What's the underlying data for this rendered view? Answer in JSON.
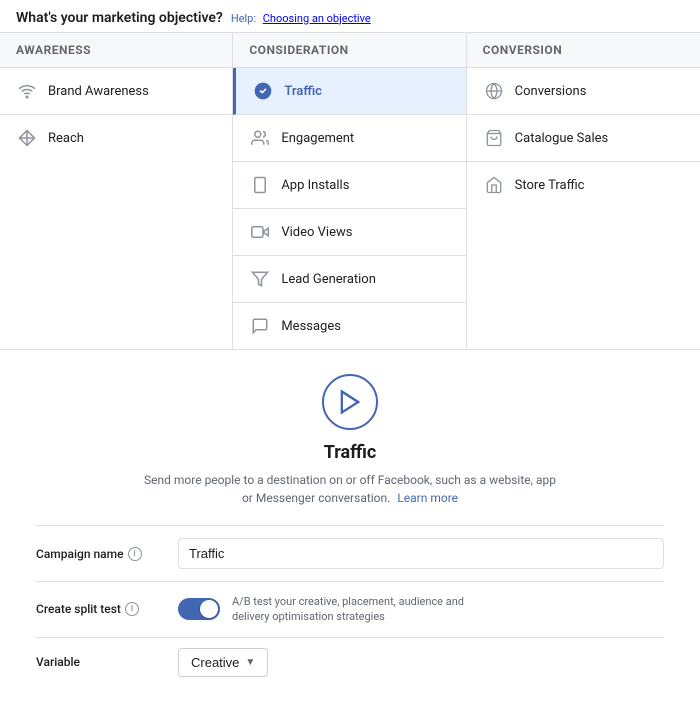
{
  "header": {
    "title": "What's your marketing objective?",
    "help_prefix": "Help:",
    "help_link": "Choosing an objective"
  },
  "columns": [
    {
      "id": "awareness",
      "header": "Awareness",
      "items": [
        {
          "id": "brand-awareness",
          "label": "Brand Awareness",
          "icon": "wifi",
          "selected": false
        },
        {
          "id": "reach",
          "label": "Reach",
          "icon": "snowflake",
          "selected": false
        }
      ]
    },
    {
      "id": "consideration",
      "header": "Consideration",
      "items": [
        {
          "id": "traffic",
          "label": "Traffic",
          "icon": "check-circle",
          "selected": true
        },
        {
          "id": "engagement",
          "label": "Engagement",
          "icon": "people",
          "selected": false
        },
        {
          "id": "app-installs",
          "label": "App Installs",
          "icon": "phone",
          "selected": false
        },
        {
          "id": "video-views",
          "label": "Video Views",
          "icon": "video",
          "selected": false
        },
        {
          "id": "lead-generation",
          "label": "Lead Generation",
          "icon": "filter",
          "selected": false
        },
        {
          "id": "messages",
          "label": "Messages",
          "icon": "chat",
          "selected": false
        }
      ]
    },
    {
      "id": "conversion",
      "header": "Conversion",
      "items": [
        {
          "id": "conversions",
          "label": "Conversions",
          "icon": "globe",
          "selected": false
        },
        {
          "id": "catalogue-sales",
          "label": "Catalogue Sales",
          "icon": "cart",
          "selected": false
        },
        {
          "id": "store-traffic",
          "label": "Store Traffic",
          "icon": "store",
          "selected": false
        }
      ]
    }
  ],
  "detail": {
    "icon": "cursor",
    "title": "Traffic",
    "description": "Send more people to a destination on or off Facebook, such as a website, app or Messenger conversation.",
    "learn_more": "Learn more"
  },
  "form": {
    "campaign_name_label": "Campaign name",
    "campaign_name_value": "Traffic",
    "campaign_name_info": "i",
    "split_test_label": "Create split test",
    "split_test_info": "i",
    "split_test_description": "A/B test your creative, placement, audience and delivery optimisation strategies",
    "variable_label": "Variable",
    "variable_value": "Creative"
  }
}
